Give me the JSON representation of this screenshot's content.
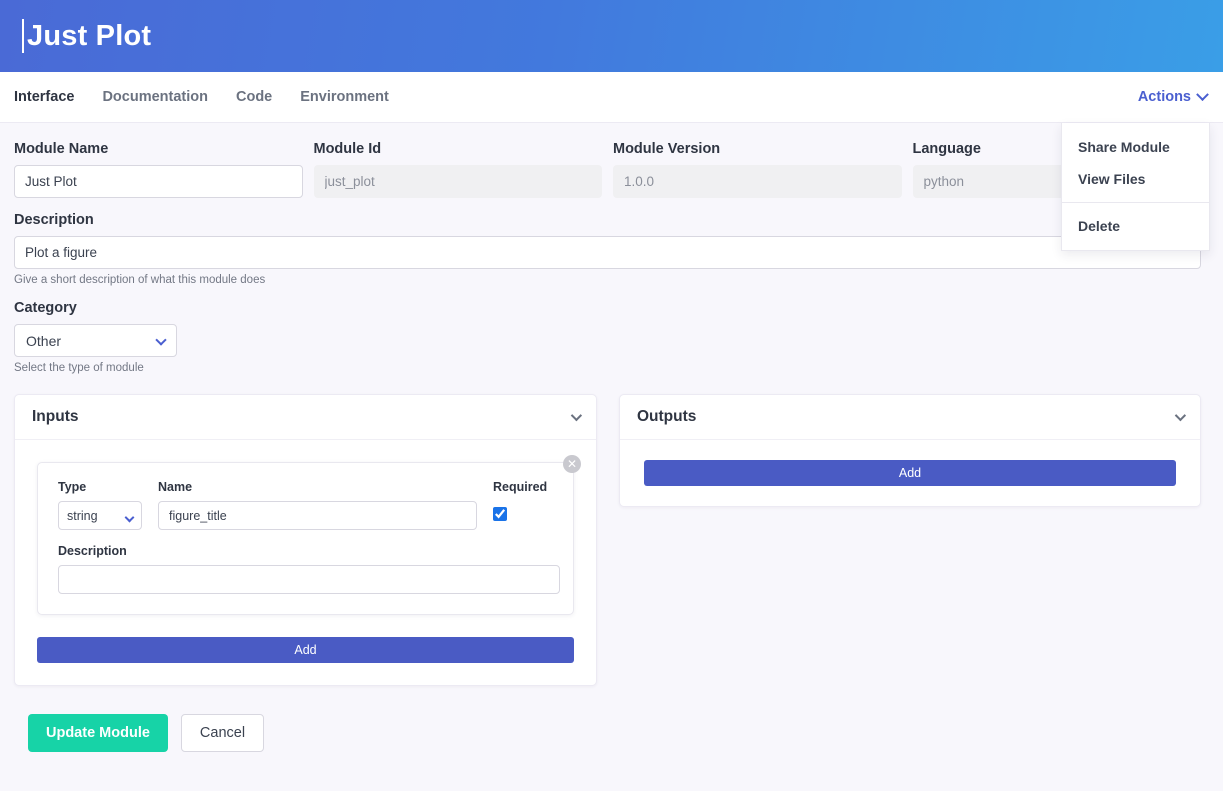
{
  "banner": {
    "title": "Just Plot"
  },
  "nav": {
    "tabs": [
      {
        "label": "Interface",
        "active": true
      },
      {
        "label": "Documentation",
        "active": false
      },
      {
        "label": "Code",
        "active": false
      },
      {
        "label": "Environment",
        "active": false
      }
    ],
    "actions_label": "Actions",
    "actions_menu": [
      {
        "label": "Share Module"
      },
      {
        "label": "View Files"
      },
      {
        "label": "Delete"
      }
    ]
  },
  "form": {
    "module_name": {
      "label": "Module Name",
      "value": "Just Plot"
    },
    "module_id": {
      "label": "Module Id",
      "value": "just_plot",
      "disabled": true
    },
    "module_version": {
      "label": "Module Version",
      "value": "1.0.0",
      "disabled": true
    },
    "language": {
      "label": "Language",
      "value": "python",
      "disabled": true
    },
    "description": {
      "label": "Description",
      "value": "Plot a figure",
      "help": "Give a short description of what this module does"
    },
    "category": {
      "label": "Category",
      "value": "Other",
      "options": [
        "Other"
      ],
      "help": "Select the type of module"
    }
  },
  "inputs_panel": {
    "title": "Inputs",
    "add_label": "Add",
    "items": [
      {
        "type_label": "Type",
        "type_value": "string",
        "type_options": [
          "string"
        ],
        "name_label": "Name",
        "name_value": "figure_title",
        "required_label": "Required",
        "required_checked": true,
        "description_label": "Description",
        "description_value": "",
        "close_glyph": "✕"
      }
    ]
  },
  "outputs_panel": {
    "title": "Outputs",
    "add_label": "Add",
    "items": []
  },
  "footer": {
    "update_label": "Update Module",
    "cancel_label": "Cancel"
  },
  "colors": {
    "banner_left": "#4a6ad6",
    "banner_right": "#3a9ee7",
    "accent_link": "#4a5fd0",
    "add_button": "#4a5bc4",
    "primary": "#17d3a7",
    "page_bg": "#f8f7fc"
  }
}
